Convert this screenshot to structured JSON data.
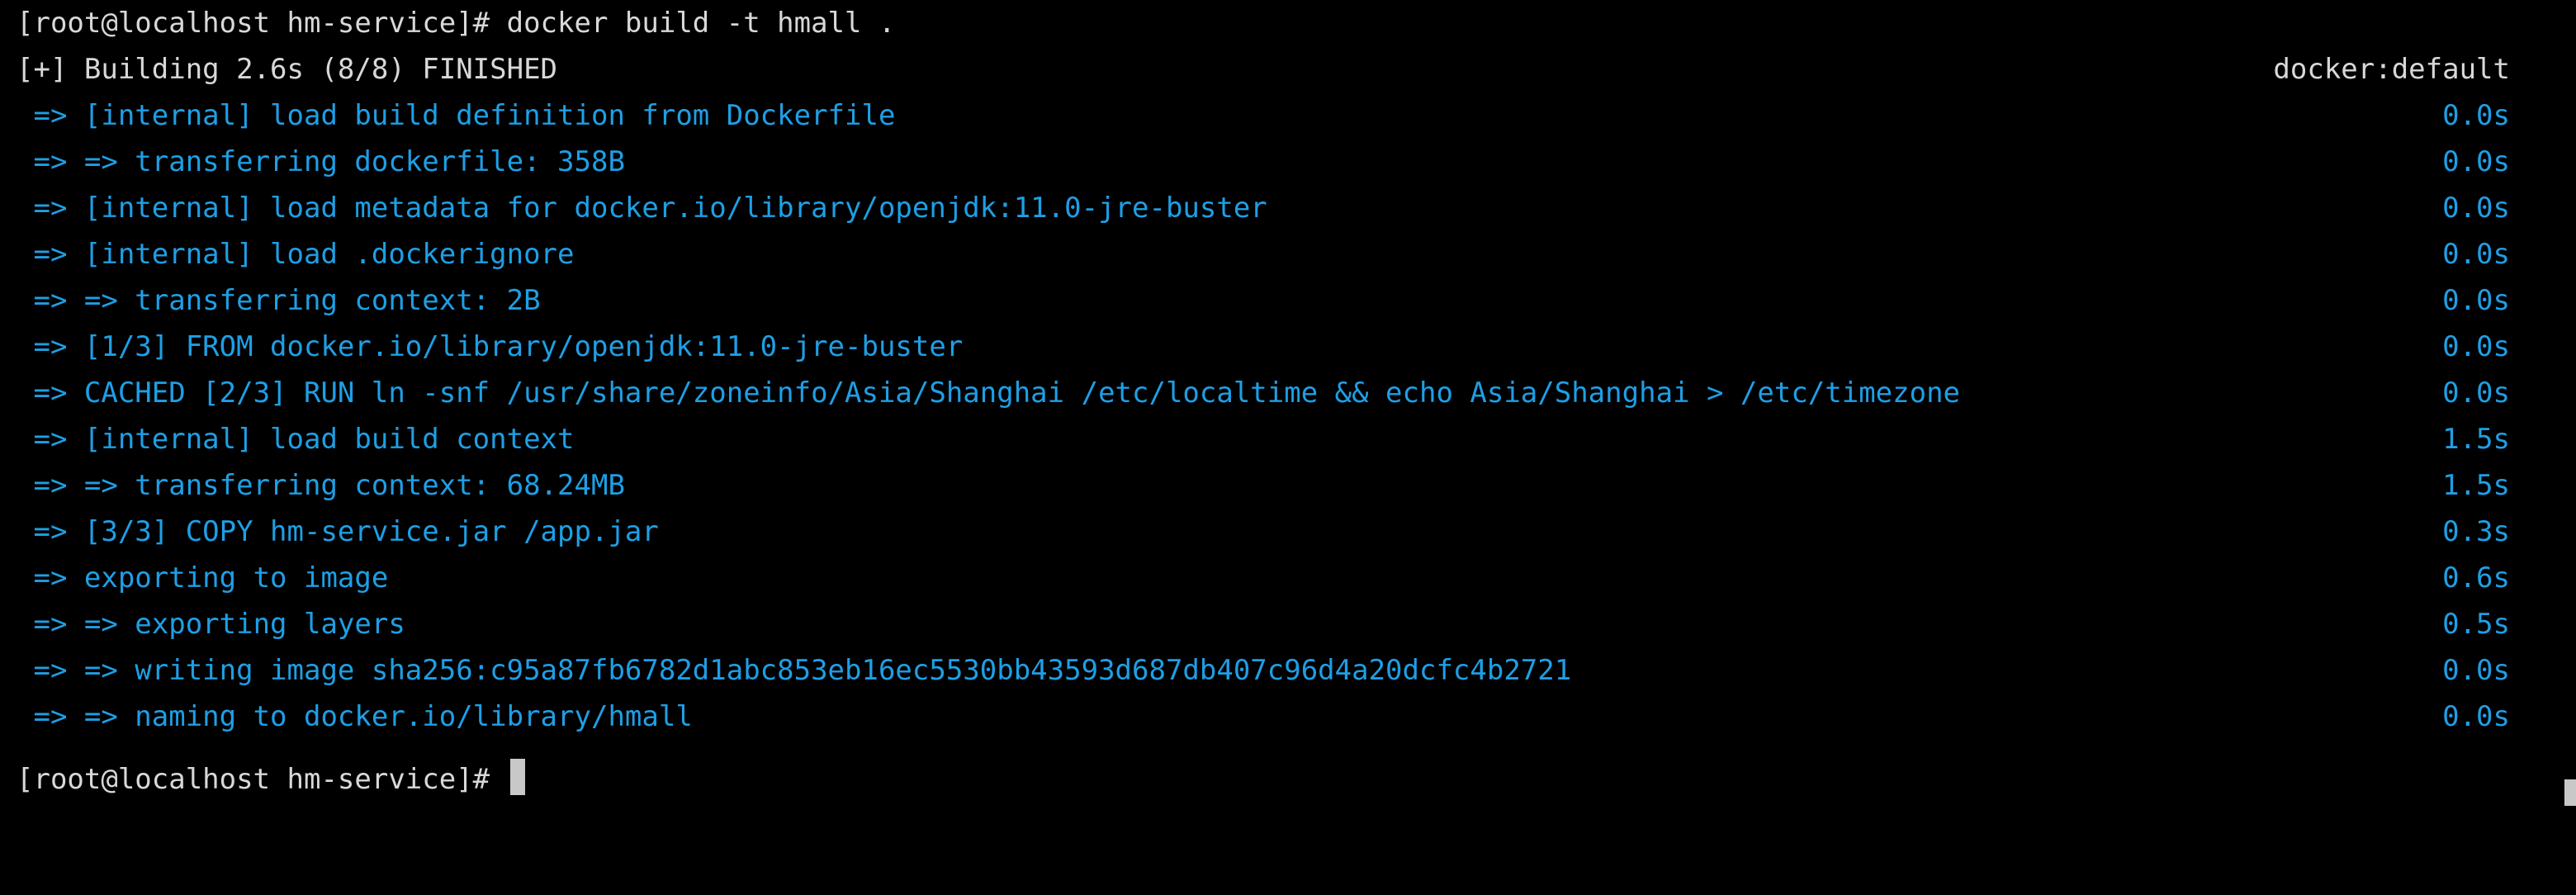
{
  "colors": {
    "background": "#000000",
    "plain": "#d8d8d8",
    "step": "#1e9fe5",
    "cursor": "#c8c8c8"
  },
  "terminal": {
    "command_prompt": "[root@localhost hm-service]# docker build -t hmall .",
    "status": "[+] Building 2.6s (8/8) FINISHED",
    "status_context": "docker:default",
    "steps": [
      {
        "text": " => [internal] load build definition from Dockerfile",
        "time": "0.0s"
      },
      {
        "text": " => => transferring dockerfile: 358B",
        "time": "0.0s"
      },
      {
        "text": " => [internal] load metadata for docker.io/library/openjdk:11.0-jre-buster",
        "time": "0.0s"
      },
      {
        "text": " => [internal] load .dockerignore",
        "time": "0.0s"
      },
      {
        "text": " => => transferring context: 2B",
        "time": "0.0s"
      },
      {
        "text": " => [1/3] FROM docker.io/library/openjdk:11.0-jre-buster",
        "time": "0.0s"
      },
      {
        "text": " => CACHED [2/3] RUN ln -snf /usr/share/zoneinfo/Asia/Shanghai /etc/localtime && echo Asia/Shanghai > /etc/timezone",
        "time": "0.0s"
      },
      {
        "text": " => [internal] load build context",
        "time": "1.5s"
      },
      {
        "text": " => => transferring context: 68.24MB",
        "time": "1.5s"
      },
      {
        "text": " => [3/3] COPY hm-service.jar /app.jar",
        "time": "0.3s"
      },
      {
        "text": " => exporting to image",
        "time": "0.6s"
      },
      {
        "text": " => => exporting layers",
        "time": "0.5s"
      },
      {
        "text": " => => writing image sha256:c95a87fb6782d1abc853eb16ec5530bb43593d687db407c96d4a20dcfc4b2721",
        "time": "0.0s"
      },
      {
        "text": " => => naming to docker.io/library/hmall",
        "time": "0.0s"
      }
    ],
    "final_prompt": "[root@localhost hm-service]# "
  }
}
